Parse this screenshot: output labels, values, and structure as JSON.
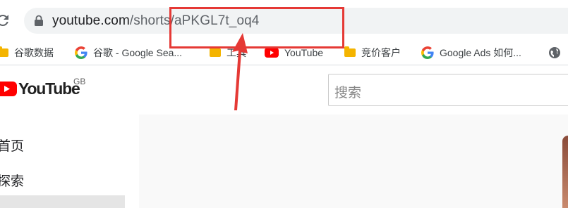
{
  "browser": {
    "url_host": "youtube.com",
    "url_path": "/shorts/aPKGL7t_oq4"
  },
  "bookmarks": [
    {
      "icon": "folder-icon",
      "label": "谷歌数据"
    },
    {
      "icon": "google-g-icon",
      "label": "谷歌 - Google Sea..."
    },
    {
      "icon": "folder-icon",
      "label": "工具"
    },
    {
      "icon": "youtube-icon",
      "label": "YouTube"
    },
    {
      "icon": "folder-icon",
      "label": "竞价客户"
    },
    {
      "icon": "google-g-icon",
      "label": "Google Ads 如何..."
    },
    {
      "icon": "globe-icon",
      "label": ""
    }
  ],
  "youtube": {
    "logo_text": "YouTube",
    "region": "GB",
    "search_placeholder": "搜索",
    "sidebar": [
      {
        "label": "首页"
      },
      {
        "label": "探索"
      }
    ]
  },
  "colors": {
    "annotation": "#e53935",
    "youtube_red": "#ff0000",
    "omnibox_bg": "#f1f3f4"
  }
}
